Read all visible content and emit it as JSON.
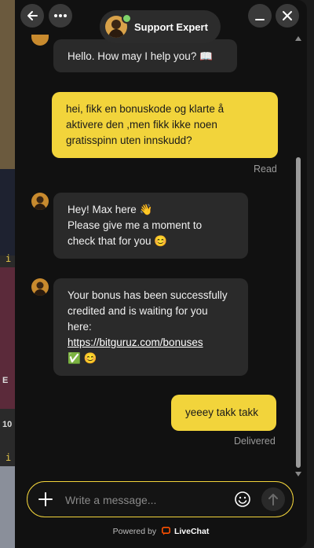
{
  "header": {
    "agent_title": "Support Expert",
    "back_icon": "arrow-left-icon",
    "menu_icon": "more-horizontal-icon",
    "minimize_icon": "minimize-icon",
    "close_icon": "close-icon"
  },
  "messages": [
    {
      "sender": "agent",
      "text": "Hello. How may I help you? 📖"
    },
    {
      "sender": "user",
      "lines": [
        "hei, fikk en bonuskode og klarte å",
        "aktivere den ,men fikk ikke noen",
        "gratisspinn uten innskudd?"
      ],
      "status": "Read"
    },
    {
      "sender": "agent",
      "lines": [
        "Hey! Max here 👋",
        "Please give me a moment to",
        "check that for you 😊"
      ]
    },
    {
      "sender": "agent",
      "lines": [
        "Your bonus has been successfully",
        "credited and is waiting for you",
        "here:"
      ],
      "link": "https://bitguruz.com/bonuses",
      "emoji": "✅ 😊"
    },
    {
      "sender": "user",
      "text": "yeeey takk takk",
      "status": "Delivered"
    }
  ],
  "composer": {
    "placeholder": "Write a message...",
    "add_icon": "plus-icon",
    "emoji_icon": "smile-icon",
    "send_icon": "arrow-up-icon"
  },
  "footer": {
    "powered_prefix": "Powered by",
    "brand": "LiveChat"
  },
  "background_page": {
    "info_glyph": "i",
    "partial_texts": [
      "E",
      "10"
    ]
  },
  "colors": {
    "accent": "#f2d43b",
    "panel": "#111111",
    "agent_bubble": "#2a2a2a"
  }
}
